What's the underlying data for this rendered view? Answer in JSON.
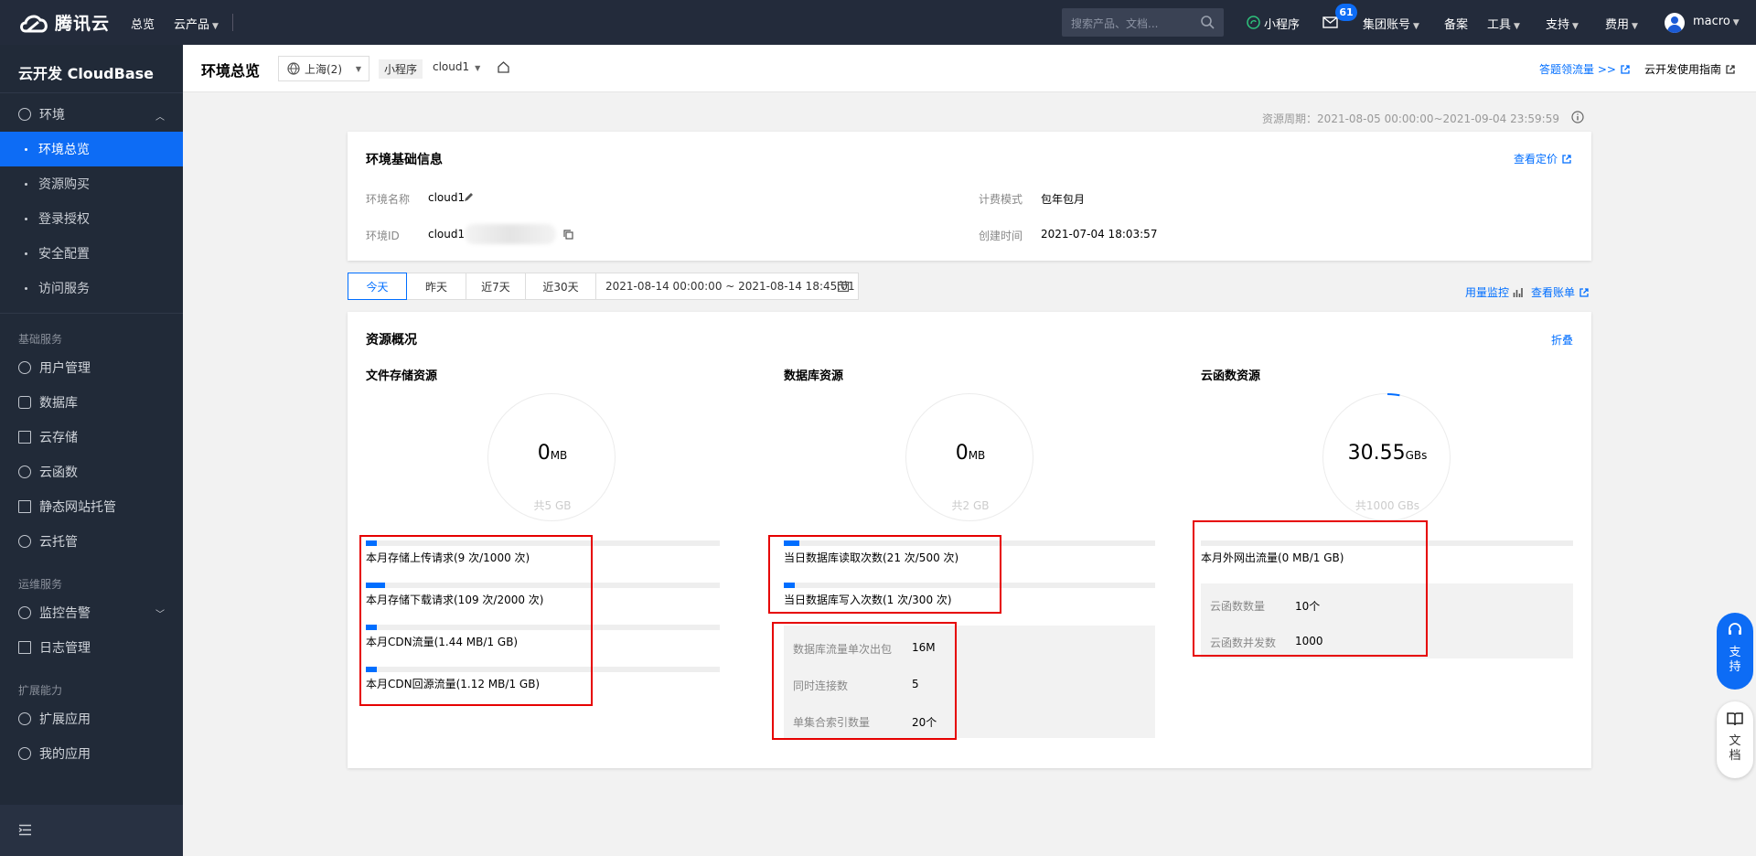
{
  "topnav": {
    "brand": "腾讯云",
    "links": {
      "overview": "总览",
      "products": "云产品",
      "miniprogram": "小程序",
      "group_account": "集团账号",
      "beian": "备案",
      "tools": "工具",
      "support": "支持",
      "fees": "费用",
      "user": "macro"
    },
    "search_placeholder": "搜索产品、文档...",
    "mail_badge": "61"
  },
  "sidebar": {
    "title": "云开发 CloudBase",
    "env_label": "环境",
    "env_items": [
      "环境总览",
      "资源购买",
      "登录授权",
      "安全配置",
      "访问服务"
    ],
    "group_basic": "基础服务",
    "basic_items": [
      "用户管理",
      "数据库",
      "云存储",
      "云函数",
      "静态网站托管",
      "云托管"
    ],
    "group_ops": "运维服务",
    "ops_items": [
      "监控告警",
      "日志管理"
    ],
    "group_ext": "扩展能力",
    "ext_items": [
      "扩展应用",
      "我的应用"
    ]
  },
  "header": {
    "title": "环境总览",
    "region": "上海(2)",
    "env_tag": "小程序",
    "env_name": "cloud1",
    "link_traffic": "答题领流量 >>",
    "link_guide": "云开发使用指南"
  },
  "period": "资源周期：2021-08-05 00:00:00~2021-09-04 23:59:59",
  "env_info": {
    "title": "环境基础信息",
    "pricing_link": "查看定价",
    "name_label": "环境名称",
    "name_value": "cloud1",
    "id_label": "环境ID",
    "id_value": "cloud1",
    "billing_label": "计费模式",
    "billing_value": "包年包月",
    "created_label": "创建时间",
    "created_value": "2021-07-04 18:03:57"
  },
  "date_tabs": {
    "tabs": [
      "今天",
      "昨天",
      "近7天",
      "近30天"
    ],
    "active": "今天",
    "range": "2021-08-14 00:00:00 ~ 2021-08-14 18:45:01",
    "usage_link": "用量监控",
    "bill_link": "查看账单"
  },
  "overview": {
    "title": "资源概况",
    "collapse": "折叠",
    "storage": {
      "title": "文件存储资源",
      "value": "0",
      "unit": "MB",
      "total": "共5 GB",
      "metrics": [
        {
          "label": "本月存储上传请求(9 次/1000 次)",
          "fraction": 0.009
        },
        {
          "label": "本月存储下载请求(109 次/2000 次)",
          "fraction": 0.0545
        },
        {
          "label": "本月CDN流量(1.44 MB/1 GB)",
          "fraction": 0.0014
        },
        {
          "label": "本月CDN回源流量(1.12 MB/1 GB)",
          "fraction": 0.0011
        }
      ]
    },
    "database": {
      "title": "数据库资源",
      "value": "0",
      "unit": "MB",
      "total": "共2 GB",
      "metrics": [
        {
          "label": "当日数据库读取次数(21 次/500 次)",
          "fraction": 0.042
        },
        {
          "label": "当日数据库写入次数(1 次/300 次)",
          "fraction": 0.0033
        }
      ],
      "limits": [
        {
          "key": "数据库流量单次出包",
          "value": "16M"
        },
        {
          "key": "同时连接数",
          "value": "5"
        },
        {
          "key": "单集合索引数量",
          "value": "20个"
        }
      ]
    },
    "functions": {
      "title": "云函数资源",
      "value": "30.55",
      "unit": "GBs",
      "total": "共1000 GBs",
      "ring_fraction": 0.0306,
      "metrics": [
        {
          "label": "本月外网出流量(0 MB/1 GB)",
          "fraction": 0
        }
      ],
      "limits": [
        {
          "key": "云函数数量",
          "value": "10个"
        },
        {
          "key": "云函数并发数",
          "value": "1000"
        }
      ]
    }
  },
  "float": {
    "support": "支持",
    "docs": "文档"
  },
  "colors": {
    "accent": "#006eff",
    "nav_bg": "#232b3b",
    "sidebar_bg": "#212a38",
    "highlight_box": "#e60000"
  }
}
